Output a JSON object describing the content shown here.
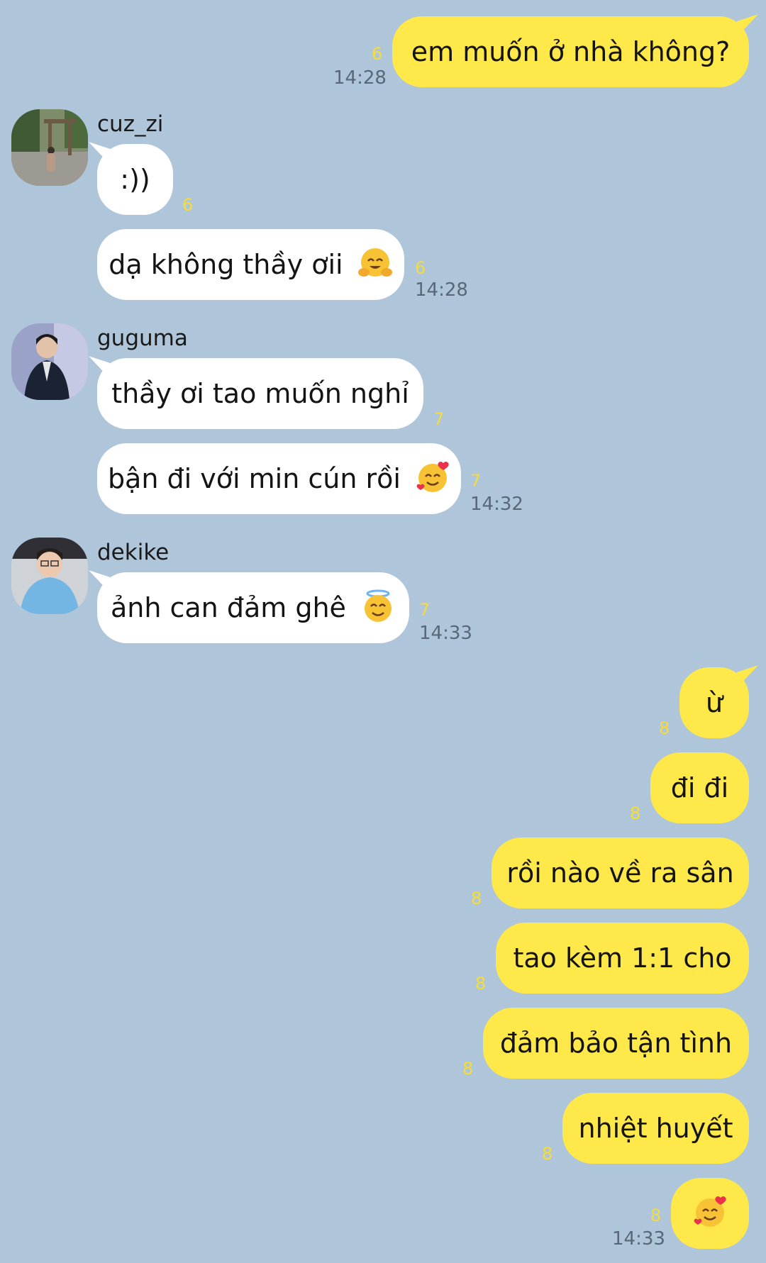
{
  "colors": {
    "background": "#afc5da",
    "outgoing_bubble": "#fee84a",
    "incoming_bubble": "#ffffff",
    "unread_count": "#f4dc3d",
    "timestamp": "#596878"
  },
  "messages": {
    "m1": {
      "text": "em muốn ở nhà không?",
      "unread": "6",
      "time": "14:28"
    },
    "g1": {
      "sender": "cuz_zi",
      "avatar": "avatar-photo-gate"
    },
    "m2": {
      "text": ":))",
      "unread": "6"
    },
    "m3": {
      "text": "dạ không thầy ơii",
      "emoji": "hugging-face-emoji",
      "unread": "6",
      "time": "14:28"
    },
    "g2": {
      "sender": "guguma",
      "avatar": "avatar-photo-suit"
    },
    "m4": {
      "text": "thầy ơi tao muốn nghỉ",
      "unread": "7"
    },
    "m5": {
      "text": "bận đi với min cún rồi",
      "emoji": "smiling-face-with-hearts-emoji",
      "unread": "7",
      "time": "14:32"
    },
    "g3": {
      "sender": "dekike",
      "avatar": "avatar-photo-jersey"
    },
    "m6": {
      "text": "ảnh can đảm ghê",
      "emoji": "smiling-face-with-halo-emoji",
      "unread": "7",
      "time": "14:33"
    },
    "m7": {
      "text": "ừ",
      "unread": "8"
    },
    "m8": {
      "text": "đi đi",
      "unread": "8"
    },
    "m9": {
      "text": "rồi nào về ra sân",
      "unread": "8"
    },
    "m10": {
      "text": "tao kèm 1:1 cho",
      "unread": "8"
    },
    "m11": {
      "text": "đảm bảo tận tình",
      "unread": "8"
    },
    "m12": {
      "text": "nhiệt huyết",
      "unread": "8"
    },
    "m13": {
      "emoji": "smiling-face-with-hearts-emoji",
      "unread": "8",
      "time": "14:33"
    }
  }
}
